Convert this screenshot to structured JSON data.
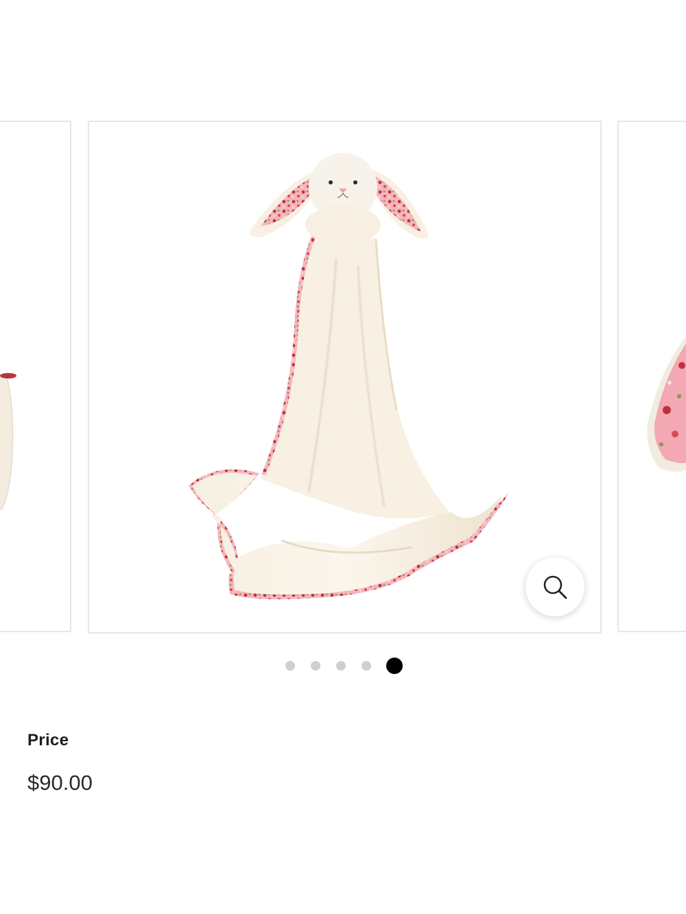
{
  "carousel": {
    "slide_count": 5,
    "active_index": 4,
    "zoom_icon": "search-icon",
    "image_subject": "bunny-blanket"
  },
  "price": {
    "label": "Price",
    "value": "$90.00"
  },
  "colors": {
    "dot_inactive": "#cfcfcf",
    "dot_active": "#000000",
    "border": "#e6e6e6",
    "blanket": "#f4ecdc",
    "floral_trim": "#e7a3ab"
  }
}
